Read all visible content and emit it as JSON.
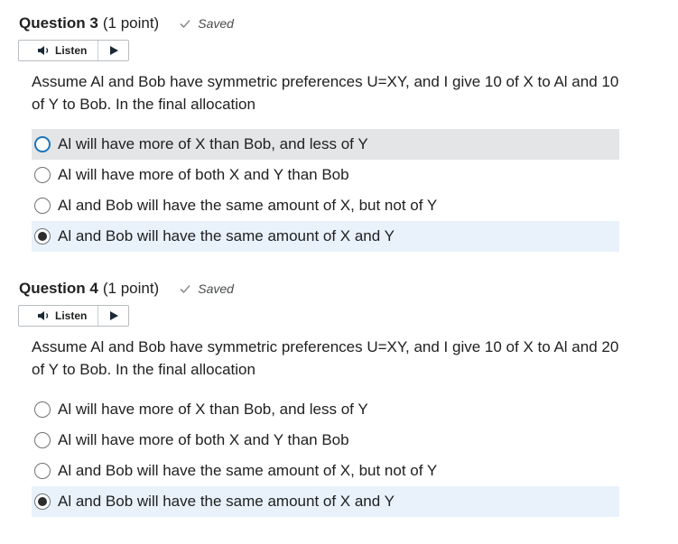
{
  "questions": [
    {
      "title": "Question 3",
      "points": "(1 point)",
      "status": "Saved",
      "listen_label": "Listen",
      "stem": "Assume Al and Bob have symmetric preferences U=XY, and I give 10 of X to Al and 10 of Y to Bob. In the final allocation",
      "options": [
        {
          "label": "Al will have more of X than Bob, and less of Y"
        },
        {
          "label": "Al will have more of both X and Y than Bob"
        },
        {
          "label": "Al and Bob will have the same amount of X, but not of Y"
        },
        {
          "label": "Al and Bob will have the same amount of X and Y"
        }
      ],
      "selected_index": 3
    },
    {
      "title": "Question 4",
      "points": "(1 point)",
      "status": "Saved",
      "listen_label": "Listen",
      "stem": "Assume Al and Bob have symmetric preferences U=XY, and I give 10 of X to Al and 20 of Y to Bob. In the final allocation",
      "options": [
        {
          "label": "Al will have more of X than Bob, and less of Y"
        },
        {
          "label": "Al will have more of both X and Y than Bob"
        },
        {
          "label": "Al and Bob will have the same amount of X, but not of Y"
        },
        {
          "label": "Al and Bob will have the same amount of X and Y"
        }
      ],
      "selected_index": 3
    }
  ],
  "icons": {
    "saved": "checkmark-icon",
    "listen": "speaker-icon",
    "play": "play-icon",
    "radio": "radio-icon"
  },
  "colors": {
    "selected_row_bg": "#e9f2fb",
    "hover_row_bg": "#e3e5e7",
    "focus_ring": "#1b75bb"
  }
}
